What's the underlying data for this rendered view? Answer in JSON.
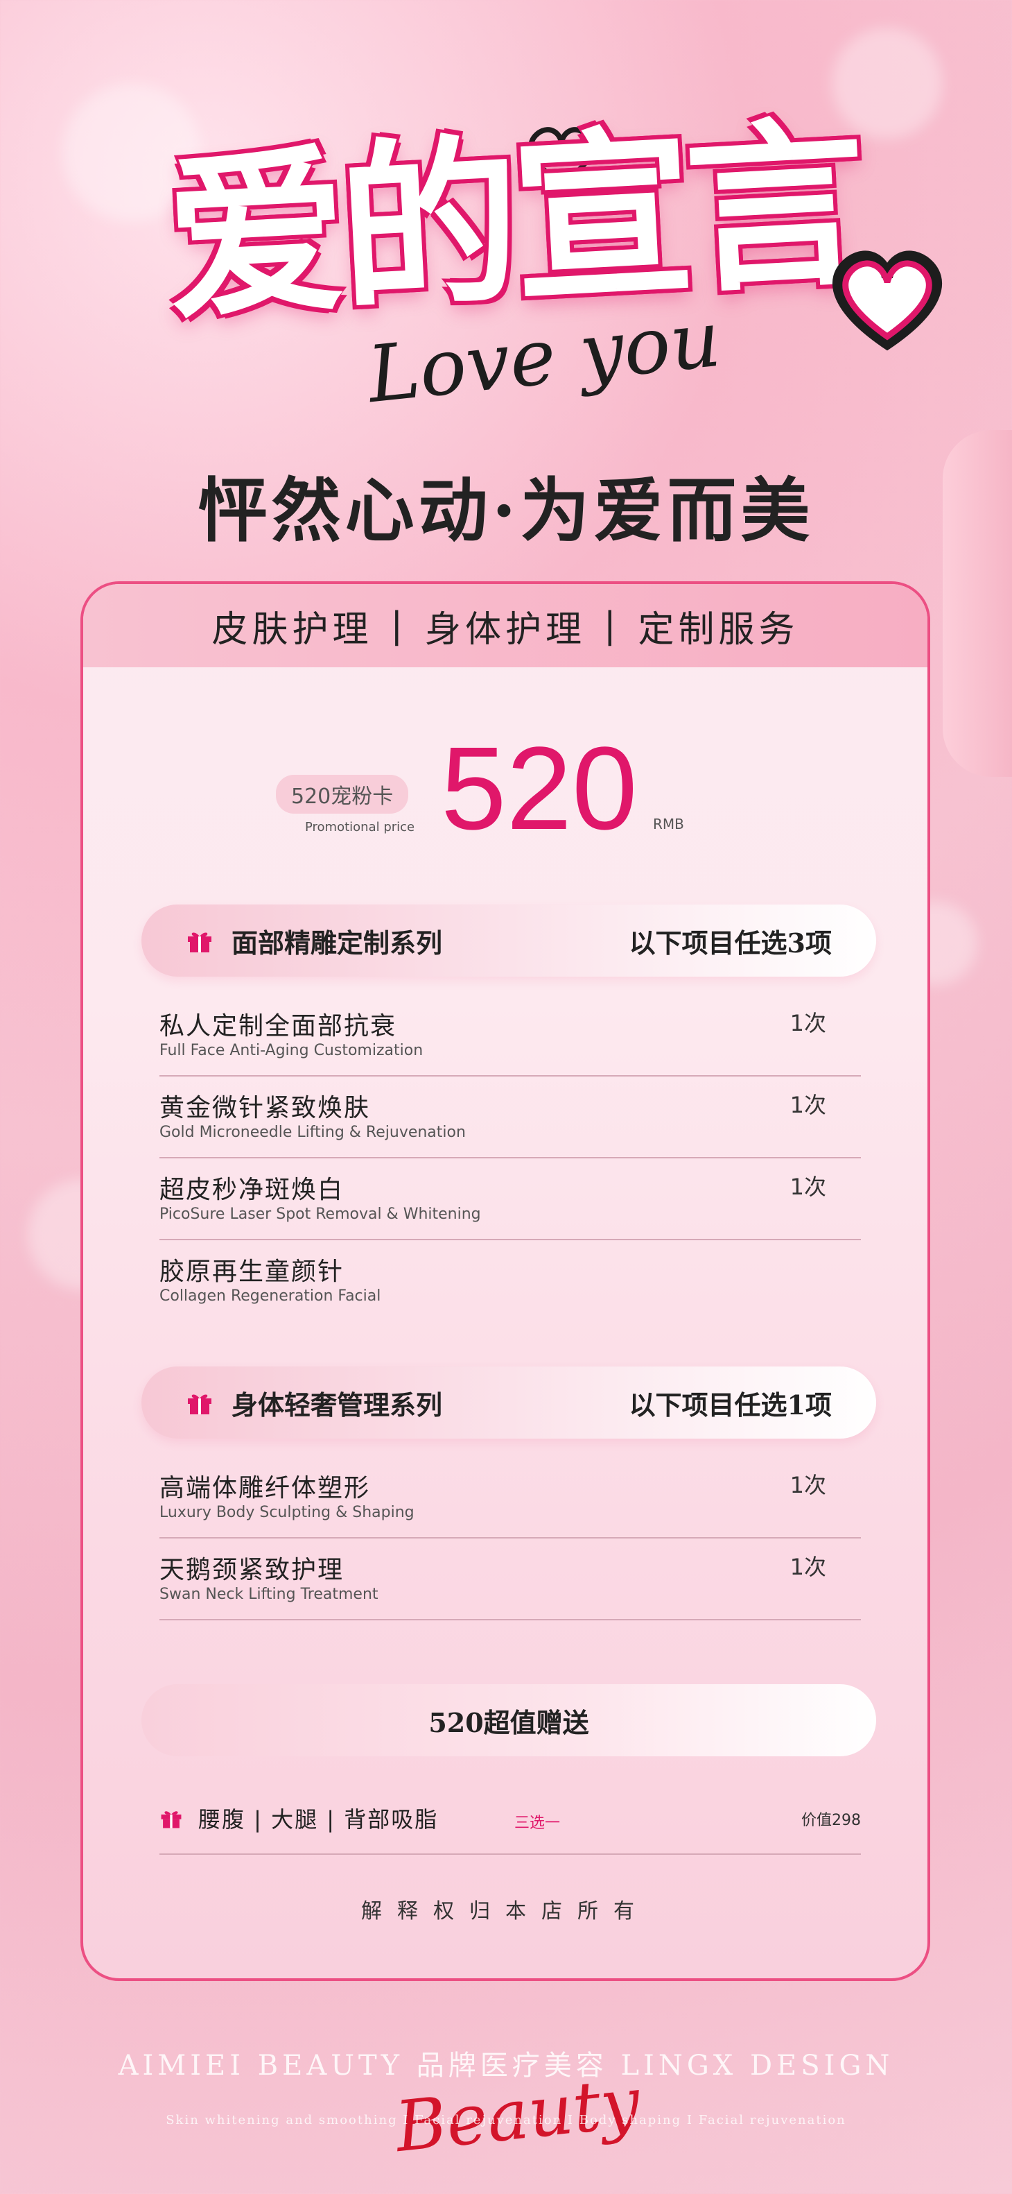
{
  "header": {
    "title_cn": "爱的宣言",
    "title_en": "Love you",
    "subtitle": "怦然心动·为爱而美"
  },
  "card": {
    "categories": [
      "皮肤护理",
      "身体护理",
      "定制服务"
    ],
    "price": {
      "pill_label": "520宠粉卡",
      "caption": "Promotional price",
      "amount": "520",
      "unit": "RMB"
    },
    "sections": [
      {
        "name": "面部精雕定制系列",
        "choose": "以下项目任选3项",
        "items": [
          {
            "cn": "私人定制全面部抗衰",
            "en": "Full Face Anti-Aging Customization",
            "count": "1次"
          },
          {
            "cn": "黄金微针紧致焕肤",
            "en": "Gold Microneedle Lifting & Rejuvenation",
            "count": "1次"
          },
          {
            "cn": "超皮秒净斑焕白",
            "en": "PicoSure Laser Spot Removal & Whitening",
            "count": "1次"
          },
          {
            "cn": "胶原再生童颜针",
            "en": "Collagen Regeneration Facial",
            "count": ""
          }
        ]
      },
      {
        "name": "身体轻奢管理系列",
        "choose": "以下项目任选1项",
        "items": [
          {
            "cn": "高端体雕纤体塑形",
            "en": "Luxury Body Sculpting & Shaping",
            "count": "1次"
          },
          {
            "cn": "天鹅颈紧致护理",
            "en": "Swan Neck Lifting Treatment",
            "count": "1次"
          }
        ]
      }
    ],
    "gift_title": "520超值赠送",
    "bonus": {
      "text": "腰腹 | 大腿 | 背部吸脂",
      "pick": "三选一",
      "value": "价值298"
    },
    "rights": "解释权归本店所有"
  },
  "footer": {
    "line1": "AIMIEI BEAUTY  品牌医疗美容  LINGX DESIGN",
    "line2": "Skin whitening and smoothing I Facial rejuvenation I Body shaping I Facial rejuvenation",
    "script": "Beauty"
  },
  "colors": {
    "accent": "#e0176a",
    "card_border": "#ec4f83"
  }
}
